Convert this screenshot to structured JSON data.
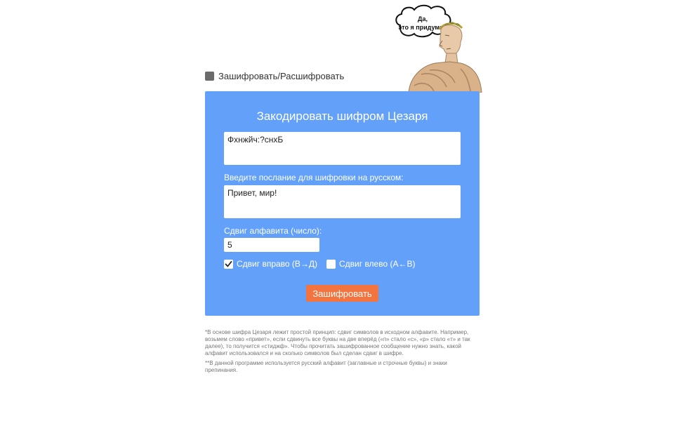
{
  "illustration": {
    "icon": "caesar-bust-illustration",
    "bubble_line1": "Да,",
    "bubble_line2": "это я придумал"
  },
  "mode_toggle": {
    "label": "Зашифровать/Расшифровать",
    "checked": true
  },
  "panel": {
    "title": "Закодировать шифром Цезаря",
    "output_value": "Фхнжйч:?снхБ",
    "message_label": "Введите послание для шифровки на русском:",
    "message_value": "Привет, мир!",
    "shift_label": "Сдвиг алфавита (число):",
    "shift_value": "5",
    "shift_right_label": "Сдвиг вправо (В→Д)",
    "shift_right_checked": true,
    "shift_left_label": "Сдвиг влево (А←В)",
    "shift_left_checked": false,
    "encrypt_button": "Зашифровать"
  },
  "footnotes": {
    "note1": "*В основе шифра Цезаря лежит простой принцип: сдвиг символов в исходном алфавите. Например, возьмем слово «привет», если сдвинуть все буквы на две вперёд («п» стало «с», «р» стало «т» и так далее), то получится «стиджф». Чтобы прочитать зашифрованное сообщение нужно знать, какой алфавит использовался и на сколько символов был сделан сдвиг в шифре.",
    "note2": "**В данной программе используется русский алфавит (заглавные и строчные буквы) и знаки препинания."
  },
  "colors": {
    "panel_bg": "#63a0f9",
    "button_bg": "#f4743f",
    "toggle_box": "#6b6b6b"
  }
}
